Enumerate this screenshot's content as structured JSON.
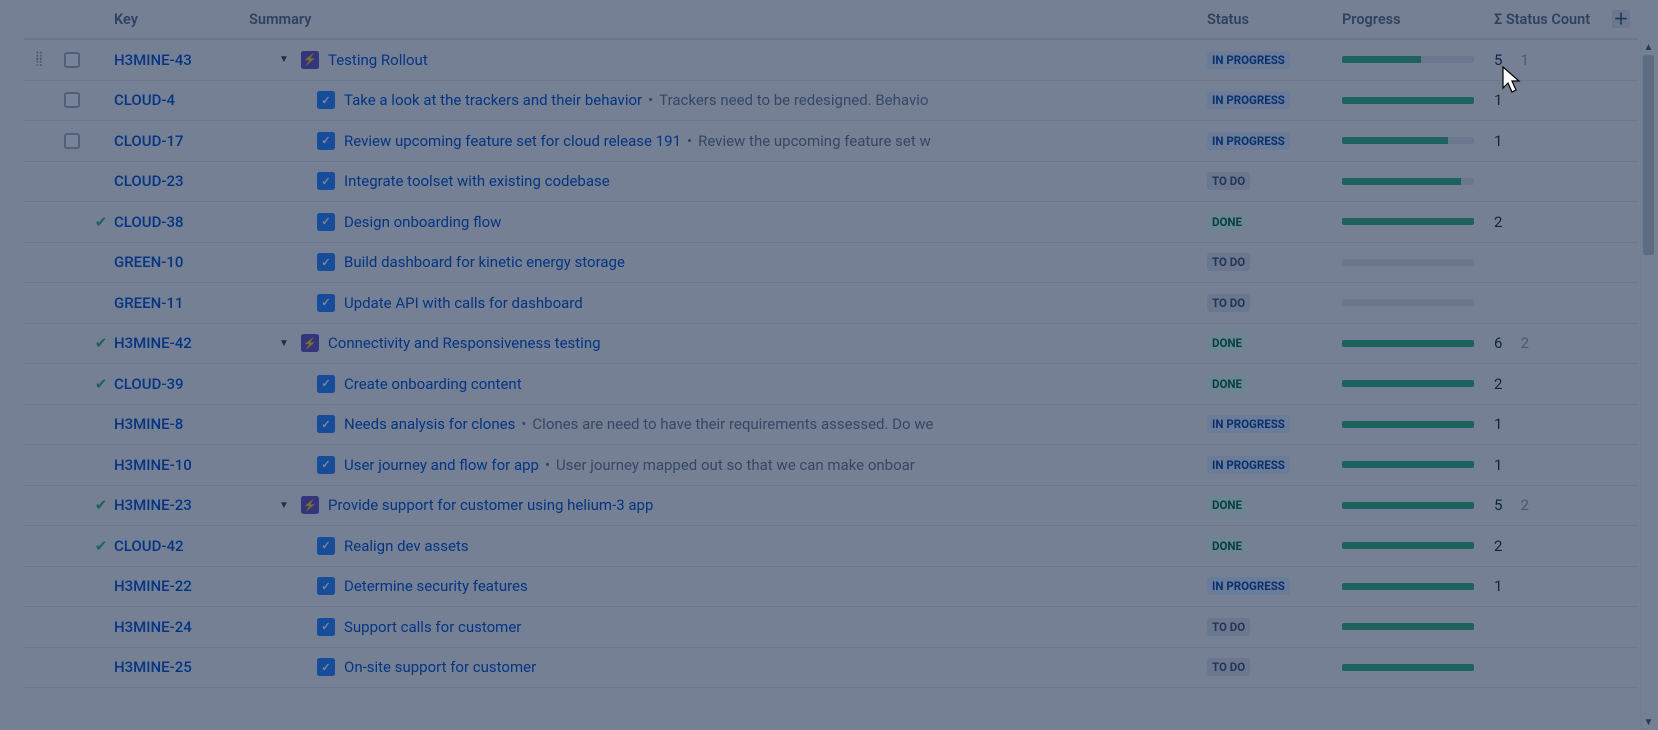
{
  "columns": {
    "key": "Key",
    "summary": "Summary",
    "status": "Status",
    "progress": "Progress",
    "statusCount": "Σ Status Count"
  },
  "statusLabels": {
    "inprogress": "IN PROGRESS",
    "todo": "TO DO",
    "done": "DONE"
  },
  "rows": [
    {
      "key": "H3MINE-43",
      "type": "epic",
      "indent": 1,
      "expandable": true,
      "done": false,
      "hovered": true,
      "checkbox": true,
      "drag": true,
      "summary": "Testing Rollout",
      "desc": "",
      "status": "inprogress",
      "progress": 60,
      "count": "5",
      "count2": "1"
    },
    {
      "key": "CLOUD-4",
      "type": "task",
      "indent": 2,
      "done": false,
      "checkbox": true,
      "summary": "Take a look at the trackers and their behavior",
      "desc": "Trackers need to be redesigned. Behavio",
      "status": "inprogress",
      "progress": 100,
      "count": "1",
      "count2": ""
    },
    {
      "key": "CLOUD-17",
      "type": "task",
      "indent": 2,
      "done": false,
      "checkbox": true,
      "summary": "Review upcoming feature set for cloud release 191",
      "desc": "Review the upcoming feature set w",
      "status": "inprogress",
      "progress": 80,
      "count": "1",
      "count2": ""
    },
    {
      "key": "CLOUD-23",
      "type": "task",
      "indent": 2,
      "done": false,
      "summary": "Integrate toolset with existing codebase",
      "desc": "",
      "status": "todo",
      "progress": 90,
      "count": "",
      "count2": ""
    },
    {
      "key": "CLOUD-38",
      "type": "task",
      "indent": 2,
      "done": true,
      "summary": "Design onboarding flow",
      "desc": "",
      "status": "done",
      "progress": 100,
      "count": "2",
      "count2": ""
    },
    {
      "key": "GREEN-10",
      "type": "task",
      "indent": 2,
      "done": false,
      "summary": "Build dashboard for kinetic energy storage",
      "desc": "",
      "status": "todo",
      "progress": 0,
      "count": "",
      "count2": ""
    },
    {
      "key": "GREEN-11",
      "type": "task",
      "indent": 2,
      "done": false,
      "summary": "Update API with calls for dashboard",
      "desc": "",
      "status": "todo",
      "progress": 0,
      "count": "",
      "count2": ""
    },
    {
      "key": "H3MINE-42",
      "type": "epic",
      "indent": 1,
      "expandable": true,
      "done": true,
      "summary": "Connectivity and Responsiveness testing",
      "desc": "",
      "status": "done",
      "progress": 100,
      "count": "6",
      "count2": "2"
    },
    {
      "key": "CLOUD-39",
      "type": "task",
      "indent": 2,
      "done": true,
      "summary": "Create onboarding content",
      "desc": "",
      "status": "done",
      "progress": 100,
      "count": "2",
      "count2": ""
    },
    {
      "key": "H3MINE-8",
      "type": "task",
      "indent": 2,
      "done": false,
      "summary": "Needs analysis for clones",
      "desc": "Clones are need to have their requirements assessed. Do we",
      "status": "inprogress",
      "progress": 100,
      "count": "1",
      "count2": ""
    },
    {
      "key": "H3MINE-10",
      "type": "task",
      "indent": 2,
      "done": false,
      "summary": "User journey and flow for app",
      "desc": "User journey mapped out so that we can make onboar",
      "status": "inprogress",
      "progress": 100,
      "count": "1",
      "count2": ""
    },
    {
      "key": "H3MINE-23",
      "type": "epic",
      "indent": 1,
      "expandable": true,
      "done": true,
      "summary": "Provide support for customer using helium-3 app",
      "desc": "",
      "status": "done",
      "progress": 100,
      "count": "5",
      "count2": "2"
    },
    {
      "key": "CLOUD-42",
      "type": "task",
      "indent": 2,
      "done": true,
      "summary": "Realign dev assets",
      "desc": "",
      "status": "done",
      "progress": 100,
      "count": "2",
      "count2": ""
    },
    {
      "key": "H3MINE-22",
      "type": "task",
      "indent": 2,
      "done": false,
      "summary": "Determine security features",
      "desc": "",
      "status": "inprogress",
      "progress": 100,
      "count": "1",
      "count2": ""
    },
    {
      "key": "H3MINE-24",
      "type": "task",
      "indent": 2,
      "done": false,
      "summary": "Support calls for customer",
      "desc": "",
      "status": "todo",
      "progress": 100,
      "count": "",
      "count2": ""
    },
    {
      "key": "H3MINE-25",
      "type": "task",
      "indent": 2,
      "done": false,
      "summary": "On-site support for customer",
      "desc": "",
      "status": "todo",
      "progress": 100,
      "count": "",
      "count2": ""
    }
  ]
}
